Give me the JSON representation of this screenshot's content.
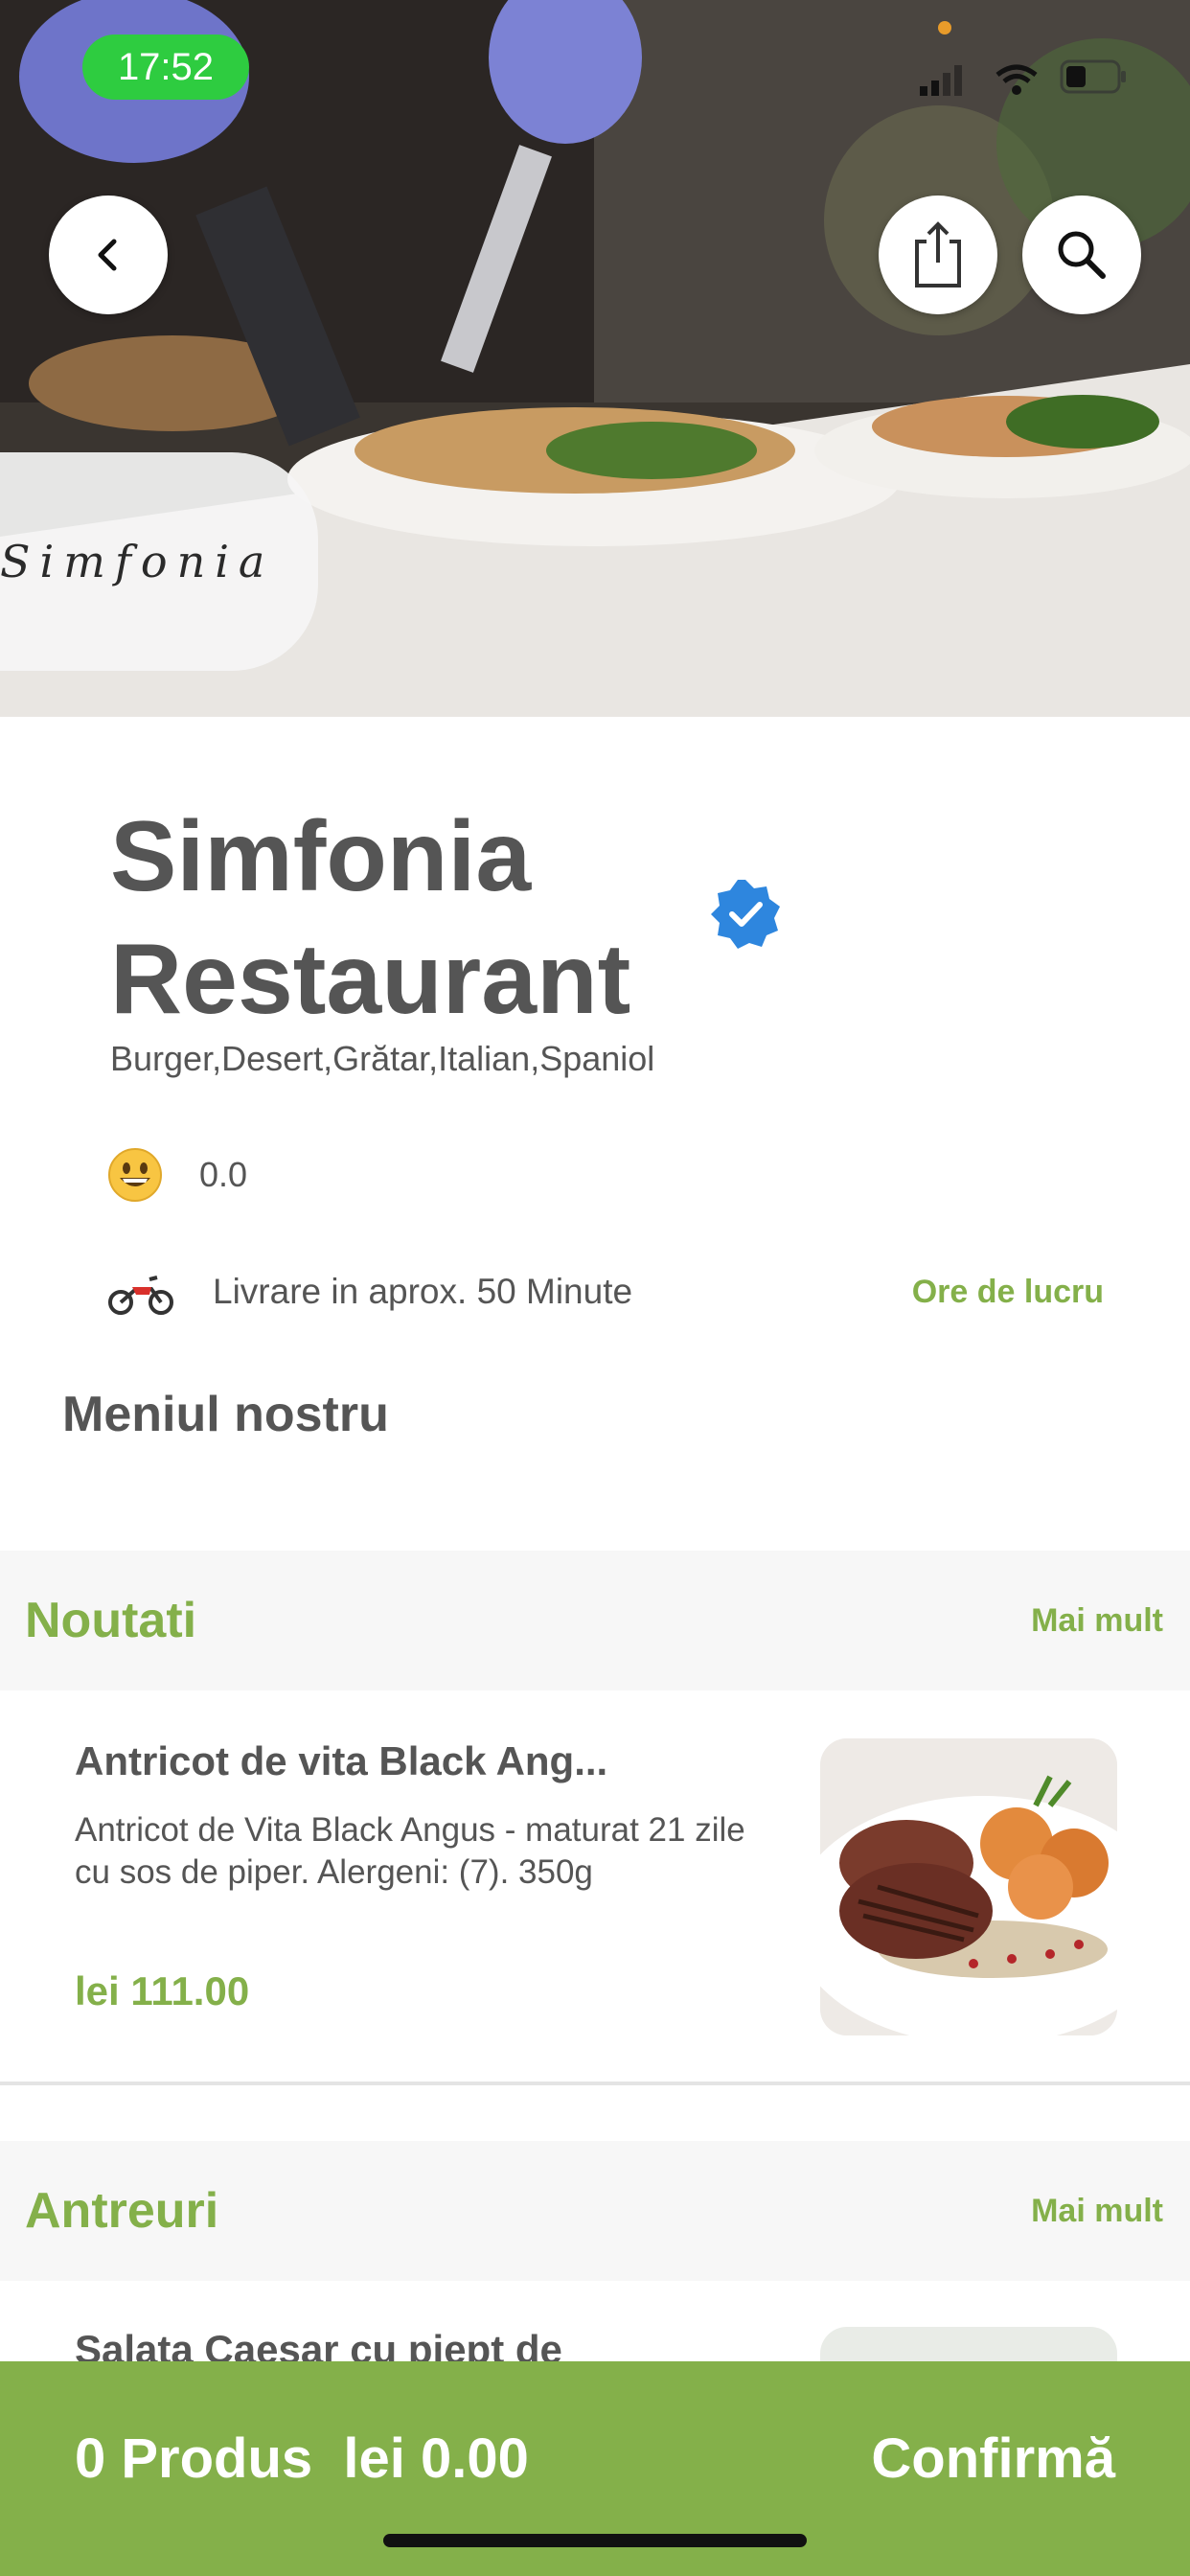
{
  "status_bar": {
    "time": "17:52"
  },
  "header": {
    "back_icon": "chevron-left-icon",
    "share_icon": "share-icon",
    "search_icon": "search-icon",
    "logo_text": "Simfonia"
  },
  "restaurant": {
    "name": "Simfonia Restaurant",
    "cuisines": "Burger,Desert,Grătar,Italian,Spaniol",
    "rating": "0.0",
    "delivery": "Livrare in aprox. 50 Minute",
    "hours_link": "Ore de lucru",
    "verified_color": "#2e86de"
  },
  "menu": {
    "heading": "Meniul nostru",
    "categories": [
      {
        "title": "Noutati",
        "more": "Mai mult",
        "items": [
          {
            "name": "Antricot de vita Black Ang...",
            "description": "Antricot de Vita Black Angus - maturat 21 zile cu sos de piper. Alergeni: (7). 350g",
            "price": "lei 111.00"
          }
        ]
      },
      {
        "title": "Antreuri",
        "more": "Mai mult",
        "items": [
          {
            "name": "Salata Caesar cu piept de"
          }
        ]
      }
    ]
  },
  "cart": {
    "count": "0 Produs",
    "total": "lei 0.00",
    "confirm": "Confirmă"
  },
  "colors": {
    "accent": "#84b04a",
    "status_green": "#2ecc40"
  }
}
